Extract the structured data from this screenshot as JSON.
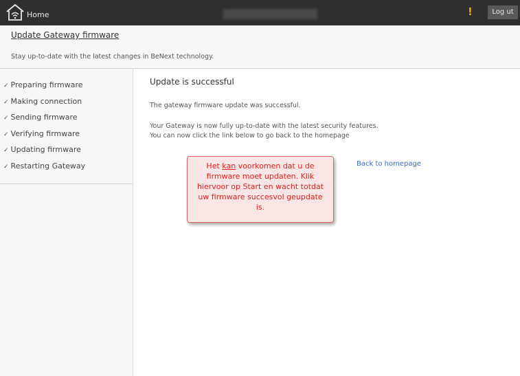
{
  "topbar": {
    "home_label": "Home",
    "alert_symbol": "!",
    "logout_label": "Log ut"
  },
  "header": {
    "title": "Update Gateway firmware",
    "subtitle": "Stay up-to-date with the latest changes in BeNext technology."
  },
  "sidebar": {
    "check_symbol": "✓",
    "steps": [
      {
        "label": "Preparing firmware"
      },
      {
        "label": "Making connection"
      },
      {
        "label": "Sending firmware"
      },
      {
        "label": "Verifying firmware"
      },
      {
        "label": "Updating firmware"
      },
      {
        "label": "Restarting Gateway"
      }
    ]
  },
  "main": {
    "heading": "Update is successful",
    "paragraph1": "The gateway firmware update was successful.",
    "paragraph2_line1": "Your Gateway is now fully up-to-date with the latest security features.",
    "paragraph2_line2": "You can now click the link below to go back to the homepage",
    "back_link": "Back to homepage"
  },
  "callout": {
    "part1": "Het ",
    "underlined": "kan",
    "part2": " voorkomen dat u de firmware moet updaten. Klik hiervoor op Start en wacht totdat uw firmware succesvol geupdate is."
  },
  "colors": {
    "topbar": "#2f2f2f",
    "callout_text": "#e02020",
    "link": "#3a6bc4",
    "alert": "#f0a020"
  },
  "icons": {
    "home": "home-icon"
  }
}
